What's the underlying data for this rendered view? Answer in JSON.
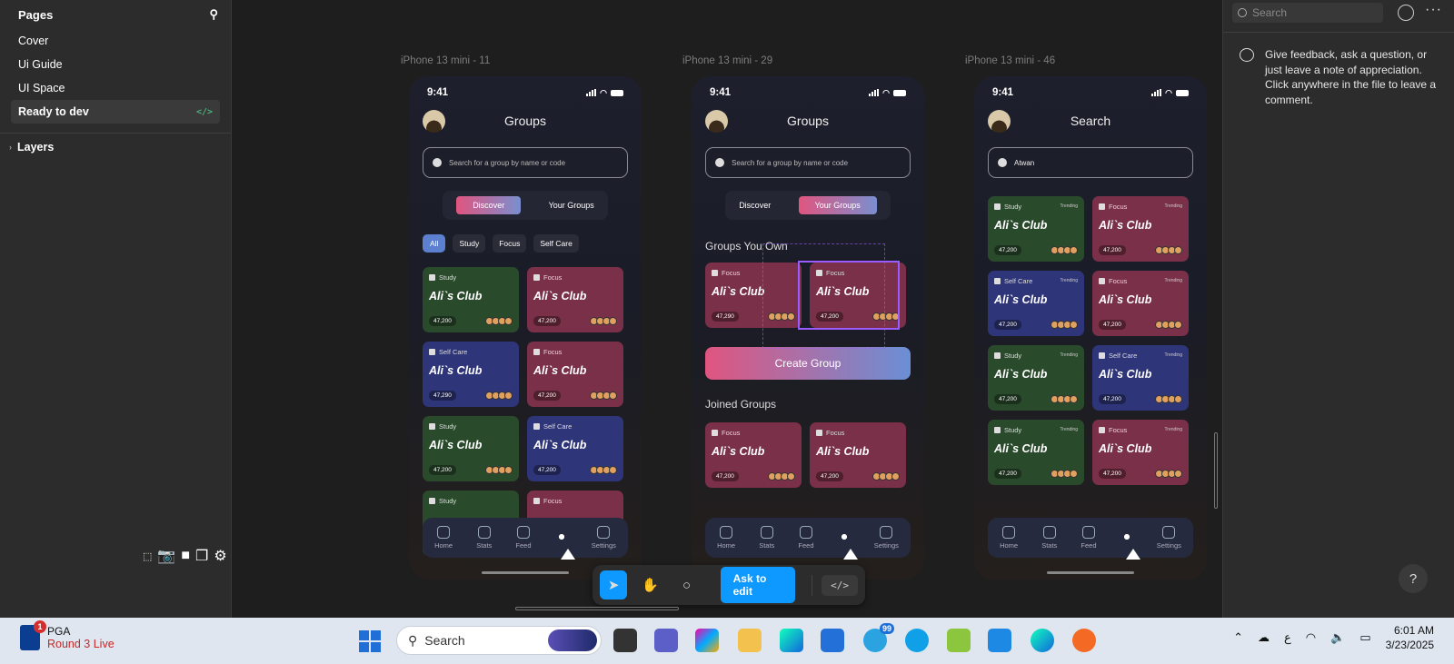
{
  "left_panel": {
    "title": "Pages",
    "pages": [
      {
        "label": "Cover"
      },
      {
        "label": "Ui Guide"
      },
      {
        "label": "UI Space"
      },
      {
        "label": "Ready to dev",
        "dev": "</>"
      }
    ],
    "layers_label": "Layers"
  },
  "frames": [
    {
      "label": "iPhone 13 mini - 11",
      "time": "9:41",
      "title": "Groups",
      "search_placeholder": "Search for a group by name or code",
      "toggle": [
        "Discover",
        "Your Groups"
      ],
      "chips": [
        "All",
        "Study",
        "Focus",
        "Self Care"
      ],
      "cards": [
        {
          "tag": "Study",
          "name": "Ali`s Club",
          "pts": "47,200",
          "color": "g"
        },
        {
          "tag": "Focus",
          "name": "Ali`s Club",
          "pts": "47,200",
          "color": "p"
        },
        {
          "tag": "Self Care",
          "name": "Ali`s Club",
          "pts": "47,290",
          "color": "b"
        },
        {
          "tag": "Focus",
          "name": "Ali`s Club",
          "pts": "47,200",
          "color": "p"
        },
        {
          "tag": "Study",
          "name": "Ali`s Club",
          "pts": "47,200",
          "color": "g"
        },
        {
          "tag": "Self Care",
          "name": "Ali`s Club",
          "pts": "47,200",
          "color": "b"
        },
        {
          "tag": "Study",
          "name": "",
          "pts": "",
          "color": "g"
        },
        {
          "tag": "Focus",
          "name": "",
          "pts": "",
          "color": "p"
        }
      ]
    },
    {
      "label": "iPhone 13 mini - 29",
      "time": "9:41",
      "title": "Groups",
      "search_placeholder": "Search for a group by name or code",
      "toggle": [
        "Discover",
        "Your Groups"
      ],
      "own_title": "Groups You Own",
      "create": "Create Group",
      "joined_title": "Joined Groups",
      "cards": [
        {
          "tag": "Focus",
          "name": "Ali`s Club",
          "pts": "47,290",
          "color": "p"
        },
        {
          "tag": "Focus",
          "name": "Ali`s Club",
          "pts": "47,200",
          "color": "p"
        },
        {
          "tag": "Focus",
          "name": "Ali`s Club",
          "pts": "47,200",
          "color": "p"
        },
        {
          "tag": "Focus",
          "name": "Ali`s Club",
          "pts": "47,200",
          "color": "p"
        }
      ]
    },
    {
      "label": "iPhone 13 mini - 46",
      "time": "9:41",
      "title": "Search",
      "search_value": "Atwan",
      "trending": "Trending",
      "cards": [
        {
          "tag": "Study",
          "name": "Ali`s Club",
          "pts": "47,200",
          "color": "g"
        },
        {
          "tag": "Focus",
          "name": "Ali`s Club",
          "pts": "47,200",
          "color": "p"
        },
        {
          "tag": "Self Care",
          "name": "Ali`s Club",
          "pts": "47,200",
          "color": "b"
        },
        {
          "tag": "Focus",
          "name": "Ali`s Club",
          "pts": "47,200",
          "color": "p"
        },
        {
          "tag": "Study",
          "name": "Ali`s Club",
          "pts": "47,200",
          "color": "g"
        },
        {
          "tag": "Self Care",
          "name": "Ali`s Club",
          "pts": "47,200",
          "color": "b"
        },
        {
          "tag": "Study",
          "name": "Ali`s Club",
          "pts": "47,200",
          "color": "g"
        },
        {
          "tag": "Focus",
          "name": "Ali`s Club",
          "pts": "47,200",
          "color": "p"
        }
      ]
    }
  ],
  "nav": [
    "Home",
    "Stats",
    "Feed",
    "",
    "Settings"
  ],
  "toolbar": {
    "ask": "Ask to edit",
    "code": "</>"
  },
  "right_panel": {
    "search_placeholder": "Search",
    "feedback": "Give feedback, ask a question, or just leave a note of appreciation. Click anywhere in the file to leave a comment.",
    "help": "?"
  },
  "taskbar": {
    "pga_title": "PGA",
    "pga_sub": "Round 3 Live",
    "pga_badge": "1",
    "search": "Search",
    "telegram_badge": "99",
    "lang": "ع",
    "time": "6:01 AM",
    "date": "3/23/2025"
  },
  "colors": {
    "accent": "#0d99ff",
    "study": "#2a4a2c",
    "focus": "#7a3048",
    "selfcare": "#2e3578"
  }
}
